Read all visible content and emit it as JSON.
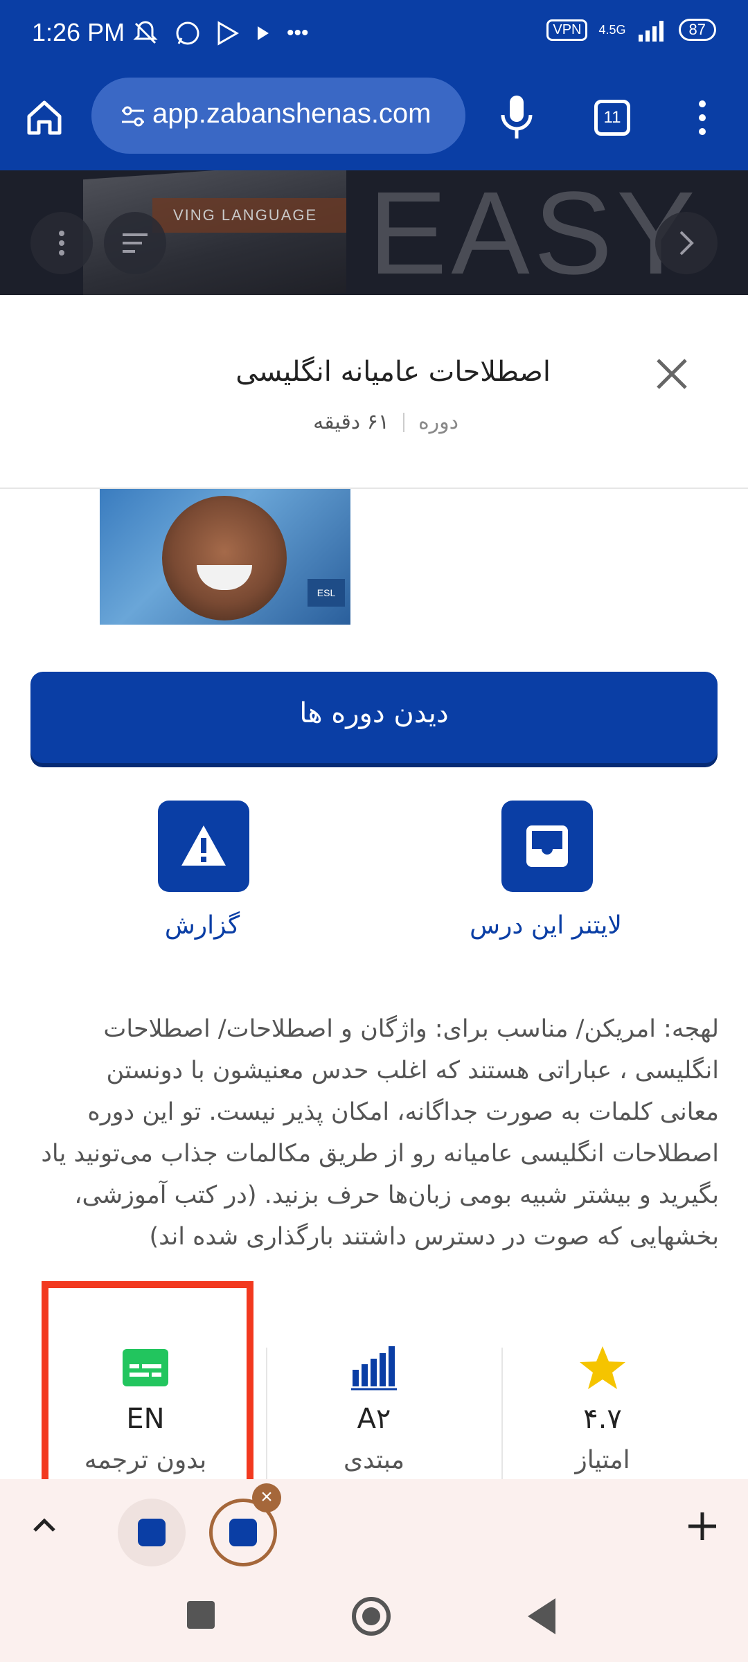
{
  "status_bar": {
    "time": "1:26 PM",
    "vpn": "VPN",
    "network": "4.5G",
    "battery": "87",
    "overflow": "•••"
  },
  "browser": {
    "url": "app.zabanshenas.com",
    "tab_count": "11"
  },
  "banner": {
    "word": "EASY",
    "book_text": "VING LANGUAGE"
  },
  "course": {
    "title": "اصطلاحات عامیانه انگلیسی",
    "type": "دوره",
    "duration": "۶۱ دقیقه",
    "cover_tag": "ESL",
    "view_courses_label": "دیدن دوره ها",
    "leitner_label": "لایتنر این درس",
    "report_label": "گزارش",
    "description": "لهجه: امریکن/ مناسب برای: واژگان و اصطلاحات/ اصطلاحات انگلیسی ، عباراتی هستند که اغلب حدس معنیشون با دونستن معانی کلمات به صورت جداگانه، امکان پذیر نیست. تو این دوره اصطلاحات انگلیسی عامیانه رو از طریق مکالمات جذاب می‌تونید یاد بگیرید و بیشتر شبیه بومی زبان‌ها حرف بزنید. (در کتب آموزشی، بخشهایی که صوت در دسترس داشتند بارگذاری شده اند)"
  },
  "stats": {
    "rating": {
      "value": "۴.۷",
      "label": "امتیاز",
      "icon": "star-icon",
      "color": "#f5c400"
    },
    "level": {
      "value": "A۲",
      "label": "مبتدی",
      "icon": "bar-chart-icon",
      "color": "#0a3ea5"
    },
    "subtitle": {
      "value": "EN",
      "label": "بدون ترجمه",
      "icon": "subtitles-icon",
      "color": "#22c55e"
    }
  },
  "tab_strip": {
    "close_glyph": "×"
  },
  "colors": {
    "brand": "#0a3ea5",
    "highlight": "#f2391f",
    "tab_accent": "#a5673a"
  }
}
